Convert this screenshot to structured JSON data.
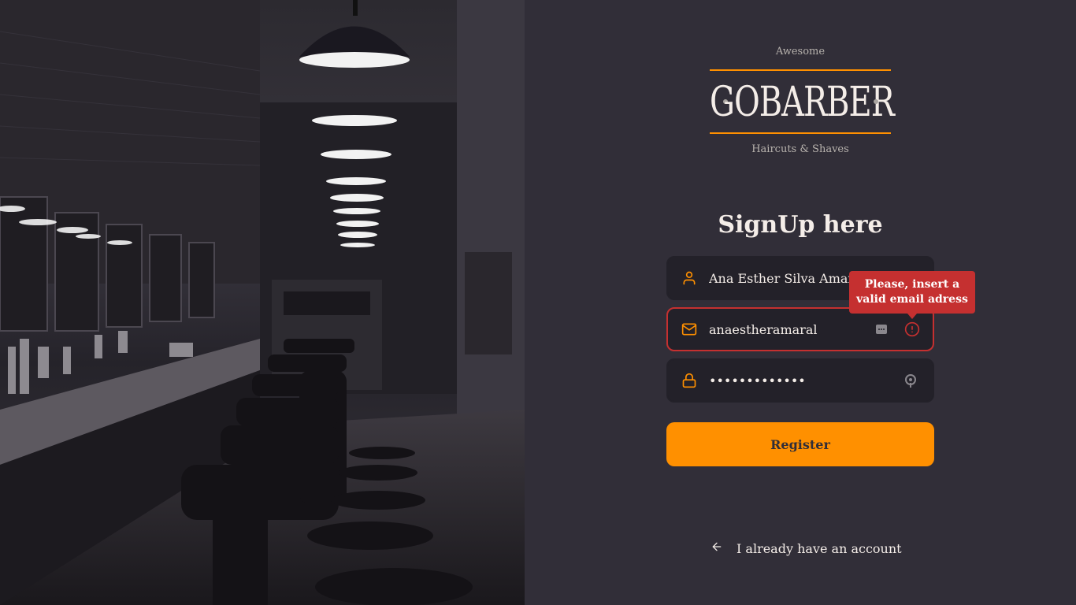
{
  "brand": {
    "top_text": "Awesome",
    "name": "GOBARBER",
    "subtitle": "Haircuts & Shaves",
    "accent_color": "#ff9000"
  },
  "form": {
    "title": "SignUp here",
    "name_field": {
      "value": "Ana Esther Silva Amaral",
      "icon": "user-icon"
    },
    "email_field": {
      "value": "anaestheramaral",
      "icon": "mail-icon",
      "error": true,
      "error_icon": "alert-circle-icon"
    },
    "password_field": {
      "value": "•••••••••••••",
      "icon": "lock-icon"
    },
    "error_tooltip": "Please, insert a valid email adress",
    "register_label": "Register"
  },
  "footer": {
    "back_label": "I already have an account",
    "back_icon": "arrow-left-icon"
  },
  "colors": {
    "background": "#312e38",
    "input_bg": "#232129",
    "error": "#c53030"
  }
}
